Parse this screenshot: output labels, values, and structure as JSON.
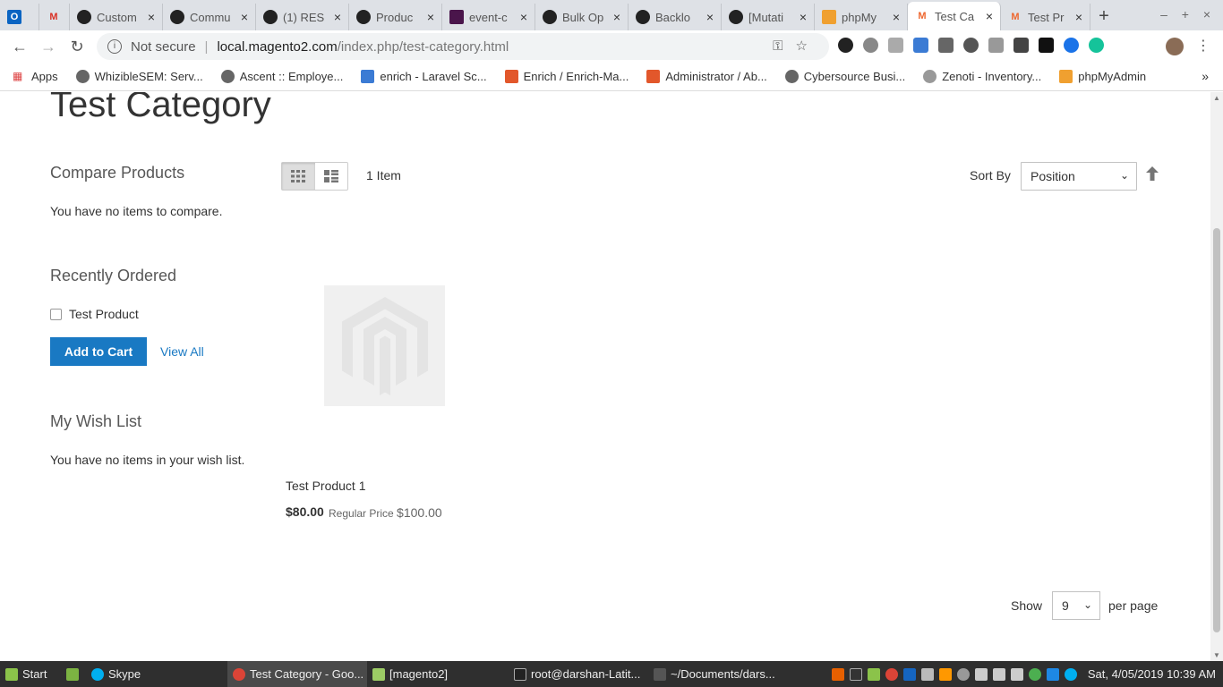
{
  "browser": {
    "tabs": [
      {
        "title": "",
        "icon": "outlook-icon"
      },
      {
        "title": "",
        "icon": "gmail-icon"
      },
      {
        "title": "Custom",
        "icon": "github-icon"
      },
      {
        "title": "Commu",
        "icon": "github-icon"
      },
      {
        "title": "(1) RES",
        "icon": "github-icon"
      },
      {
        "title": "Produc",
        "icon": "github-icon"
      },
      {
        "title": "event-c",
        "icon": "slack-icon"
      },
      {
        "title": "Bulk Op",
        "icon": "github-icon"
      },
      {
        "title": "Backlo",
        "icon": "github-icon"
      },
      {
        "title": "[Mutati",
        "icon": "github-icon"
      },
      {
        "title": "phpMy",
        "icon": "phpmyadmin-icon"
      },
      {
        "title": "Test Ca",
        "icon": "magento-icon"
      },
      {
        "title": "Test Pr",
        "icon": "magento-icon"
      }
    ],
    "new_tab": "+",
    "window_controls": "– + ×",
    "security": "Not secure",
    "url_host": "local.magento2.com",
    "url_path": "/index.php/test-category.html",
    "bookmarks": [
      {
        "label": "Apps",
        "icon": "apps-grid-icon"
      },
      {
        "label": "WhizibleSEM: Serv...",
        "icon": "globe-icon"
      },
      {
        "label": "Ascent :: Employe...",
        "icon": "globe-icon"
      },
      {
        "label": "enrich - Laravel Sc...",
        "icon": "enrich-icon"
      },
      {
        "label": "Enrich / Enrich-Ma...",
        "icon": "gitlab-icon"
      },
      {
        "label": "Administrator / Ab...",
        "icon": "gitlab-icon"
      },
      {
        "label": "Cybersource Busi...",
        "icon": "globe-icon"
      },
      {
        "label": "Zenoti - Inventory...",
        "icon": "zenoti-icon"
      },
      {
        "label": "phpMyAdmin",
        "icon": "phpmyadmin-icon"
      }
    ],
    "bookmarks_more": "»"
  },
  "page": {
    "title": "Test Category",
    "compare": {
      "title": "Compare Products",
      "empty": "You have no items to compare."
    },
    "recent": {
      "title": "Recently Ordered",
      "item": "Test Product",
      "add_to_cart": "Add to Cart",
      "view_all": "View All"
    },
    "wishlist": {
      "title": "My Wish List",
      "empty": "You have no items in your wish list."
    },
    "toolbar": {
      "amount": "1 Item",
      "sort_label": "Sort By",
      "sort_value": "Position"
    },
    "product": {
      "name": "Test Product 1",
      "price": "$80.00",
      "regular_label": "Regular Price",
      "regular_price": "$100.00"
    },
    "limiter": {
      "show_label": "Show",
      "value": "9",
      "per_page": "per page"
    }
  },
  "taskbar": {
    "items": [
      {
        "label": "Start",
        "icon": "mint-icon"
      },
      {
        "label": "",
        "icon": "desktop-icon"
      },
      {
        "label": "Skype",
        "icon": "skype-icon"
      },
      {
        "label": "Test Category - Goo...",
        "icon": "chrome-icon"
      },
      {
        "label": "[magento2]",
        "icon": "folder-icon"
      },
      {
        "label": "root@darshan-Latit...",
        "icon": "terminal-icon"
      },
      {
        "label": "~/Documents/dars...",
        "icon": "sublime-icon"
      }
    ],
    "clock": "Sat, 4/05/2019 10:39 AM"
  }
}
